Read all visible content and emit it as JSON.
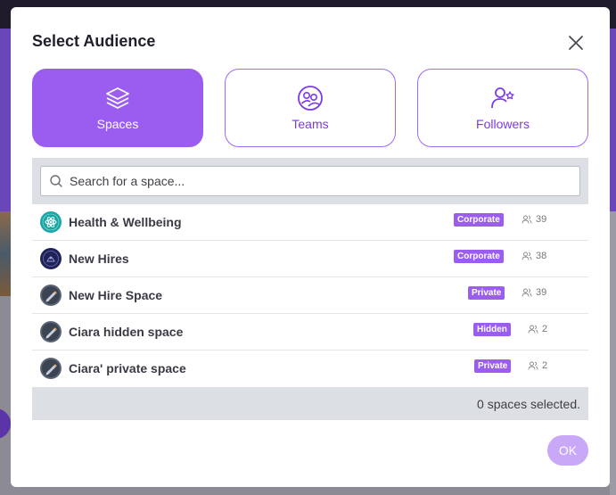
{
  "modal": {
    "title": "Select Audience",
    "ok_label": "OK"
  },
  "tabs": [
    {
      "label": "Spaces",
      "icon": "layers-icon",
      "active": true
    },
    {
      "label": "Teams",
      "icon": "team-icon",
      "active": false
    },
    {
      "label": "Followers",
      "icon": "user-star-icon",
      "active": false
    }
  ],
  "search": {
    "placeholder": "Search for a space...",
    "value": ""
  },
  "spaces": [
    {
      "name": "Health & Wellbeing",
      "badge": "Corporate",
      "members": "39",
      "avatar_color": "#17a7a5"
    },
    {
      "name": "New Hires",
      "badge": "Corporate",
      "members": "38",
      "avatar_color": "#2b2f6b"
    },
    {
      "name": "New Hire Space",
      "badge": "Private",
      "members": "39",
      "avatar_color": "#5a6576"
    },
    {
      "name": "Ciara hidden space",
      "badge": "Hidden",
      "members": "2",
      "avatar_color": "#5a6576"
    },
    {
      "name": "Ciara' private space",
      "badge": "Private",
      "members": "2",
      "avatar_color": "#5a6576"
    }
  ],
  "footer": {
    "selected_text": "0 spaces selected."
  },
  "colors": {
    "accent": "#9b5cf0",
    "ok_disabled": "#c9a8f7",
    "badge": "#9b5cf0"
  }
}
